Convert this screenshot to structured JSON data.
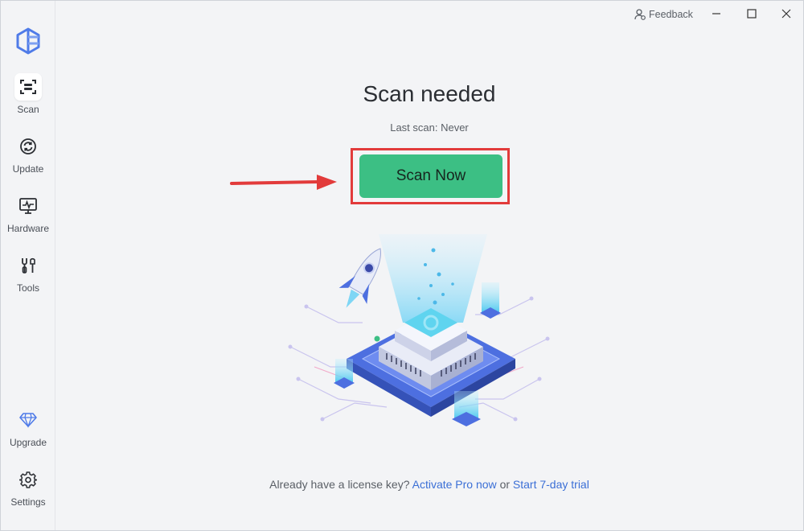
{
  "sidebar": {
    "items": [
      {
        "label": "Scan",
        "icon": "scan-icon",
        "active": true
      },
      {
        "label": "Update",
        "icon": "update-icon",
        "active": false
      },
      {
        "label": "Hardware",
        "icon": "hardware-icon",
        "active": false
      },
      {
        "label": "Tools",
        "icon": "tools-icon",
        "active": false
      },
      {
        "label": "Upgrade",
        "icon": "diamond-icon",
        "active": false
      },
      {
        "label": "Settings",
        "icon": "gear-icon",
        "active": false
      }
    ]
  },
  "titlebar": {
    "feedback_label": "Feedback"
  },
  "main": {
    "title": "Scan needed",
    "last_scan": "Last scan: Never",
    "scan_button": "Scan Now"
  },
  "footer": {
    "prompt": "Already have a license key?",
    "activate_link": "Activate Pro now",
    "or_text": "or",
    "trial_link": "Start 7-day trial"
  },
  "colors": {
    "accent_green": "#3cbf84",
    "highlight_red": "#e23b3b",
    "link_blue": "#3b6fd6",
    "logo_blue": "#4f7be8"
  }
}
